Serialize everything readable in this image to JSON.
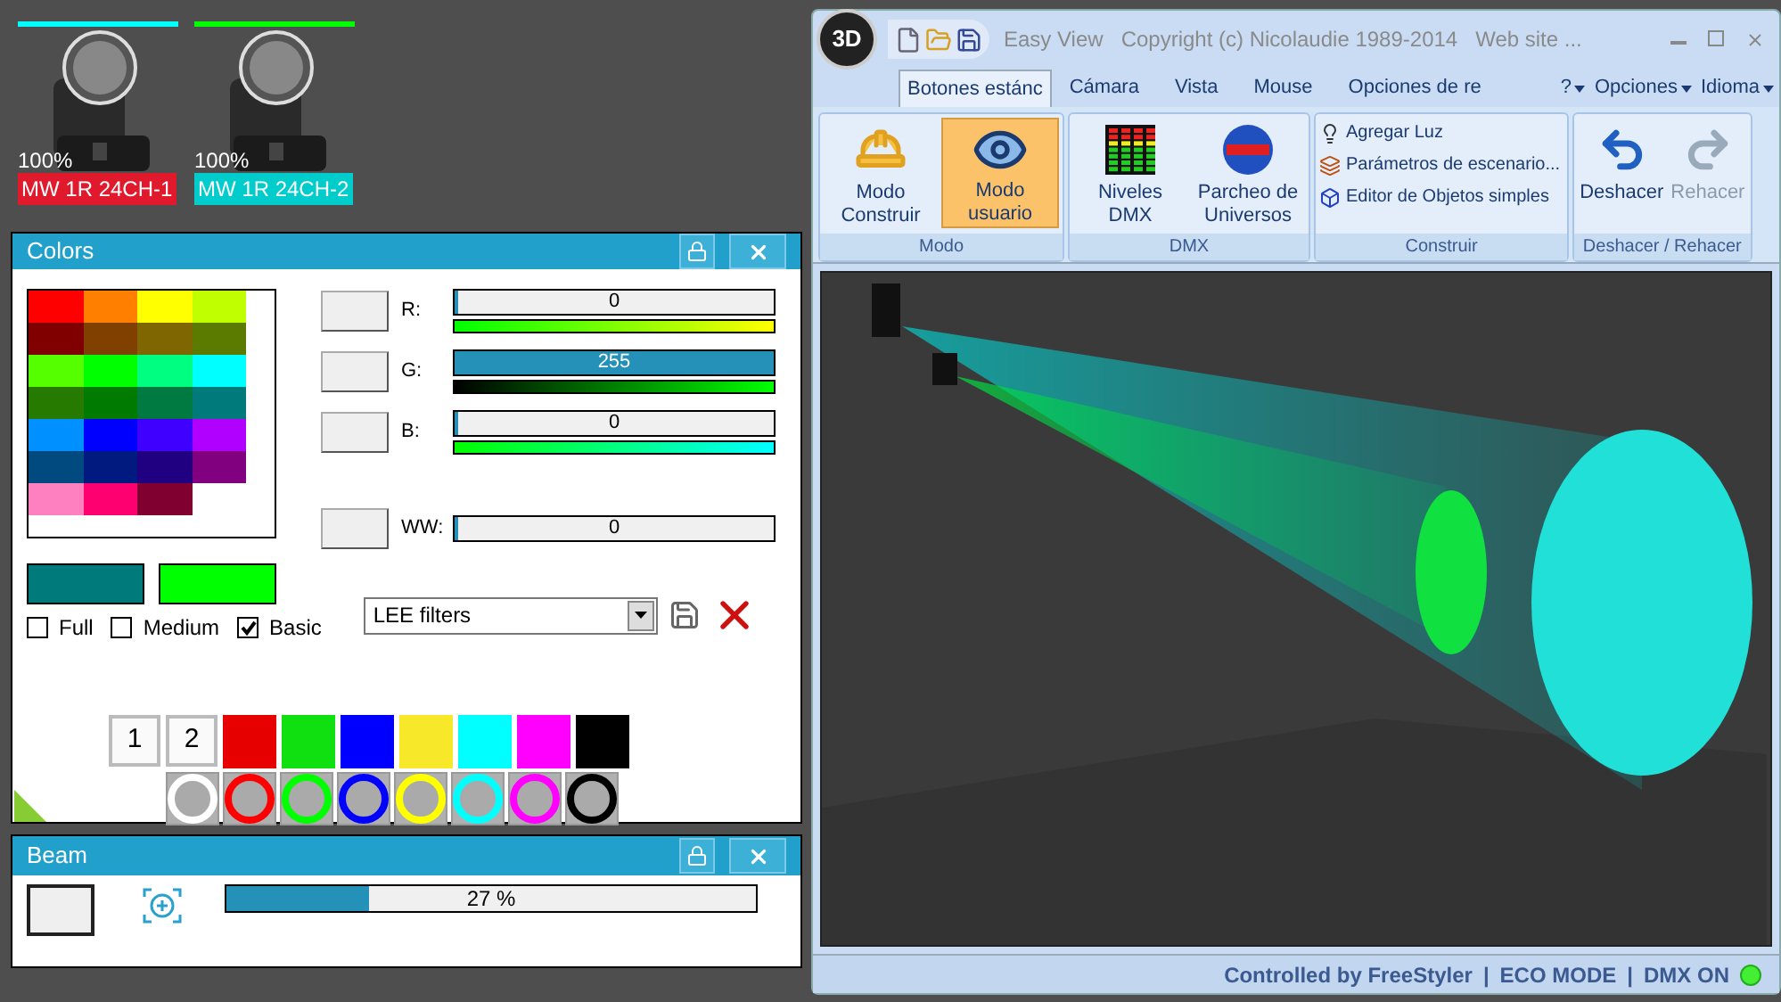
{
  "fixtures": [
    {
      "indicator": {
        "color": "#00ffff"
      },
      "intensity": "100%",
      "name": "MW 1R 24CH-1",
      "color": "#e01a2c"
    },
    {
      "indicator": {
        "color": "#00ff00"
      },
      "intensity": "100%",
      "name": "MW 1R 24CH-2",
      "color": "#00cccc"
    }
  ],
  "colors_panel": {
    "title": "Colors",
    "palette": [
      {
        "color": "#ff0000"
      },
      {
        "color": "#ff8000"
      },
      {
        "color": "#ffff00"
      },
      {
        "color": "#bfff00"
      },
      {
        "color": "#800000"
      },
      {
        "color": "#804000"
      },
      {
        "color": "#806600"
      },
      {
        "color": "#5a7a00"
      },
      {
        "color": "#55ff00"
      },
      {
        "color": "#00ff00"
      },
      {
        "color": "#00ff80"
      },
      {
        "color": "#00ffff"
      },
      {
        "color": "#267a00"
      },
      {
        "color": "#007a00"
      },
      {
        "color": "#007a40"
      },
      {
        "color": "#007a7a"
      },
      {
        "color": "#0090ff"
      },
      {
        "color": "#0000ff"
      },
      {
        "color": "#4000ff"
      },
      {
        "color": "#b000ff"
      },
      {
        "color": "#004a80"
      },
      {
        "color": "#001a80"
      },
      {
        "color": "#200080"
      },
      {
        "color": "#800080"
      },
      {
        "color": "#ff80c0"
      },
      {
        "color": "#ff0070"
      },
      {
        "color": "#800030"
      },
      {
        "color": "#ffffff"
      }
    ],
    "channels": [
      {
        "label": "R:",
        "reading": "0",
        "level": 0
      },
      {
        "label": "G:",
        "reading": "255",
        "level": 1
      },
      {
        "label": "B:",
        "reading": "0",
        "level": 0
      },
      {
        "label": "WW:",
        "reading": "0",
        "level": 0
      }
    ],
    "previews": [
      {
        "color": "#007a7a"
      },
      {
        "color": "#00ff00"
      }
    ],
    "palette_modes": [
      {
        "label": "Full",
        "checked": false
      },
      {
        "label": "Medium",
        "checked": false
      },
      {
        "label": "Basic",
        "checked": true
      }
    ],
    "filter_select": {
      "value": "LEE filters"
    },
    "presets": [
      {
        "label": "1"
      },
      {
        "label": "2"
      }
    ],
    "swatches": [
      {
        "color": "#e60000"
      },
      {
        "color": "#10e010"
      },
      {
        "color": "#0000ff"
      },
      {
        "color": "#f8e82a"
      },
      {
        "color": "#00ffff"
      },
      {
        "color": "#ff00ff"
      },
      {
        "color": "#000000"
      }
    ],
    "rings": [
      {
        "color": "#ffffff"
      },
      {
        "color": "#ff0000"
      },
      {
        "color": "#00ff00"
      },
      {
        "color": "#0000ff"
      },
      {
        "color": "#ffff00"
      },
      {
        "color": "#00ffff"
      },
      {
        "color": "#ff00ff"
      },
      {
        "color": "#000000"
      }
    ]
  },
  "beam_panel": {
    "title": "Beam",
    "level": 0.27,
    "reading": "27 %"
  },
  "window": {
    "logo": "3D",
    "title": "Easy View",
    "copyright": "Copyright (c) Nicolaudie 1989-2014",
    "website": "Web site ...",
    "tabs": [
      {
        "label": "Botones estánc",
        "selected": true
      },
      {
        "label": "Cámara",
        "selected": false
      },
      {
        "label": "Vista",
        "selected": false
      },
      {
        "label": "Mouse",
        "selected": false
      },
      {
        "label": "Opciones de re",
        "selected": false
      }
    ],
    "menus": [
      "?",
      "Opciones",
      "Idioma"
    ],
    "groups": [
      {
        "label": "Modo",
        "kind": "large",
        "items": [
          {
            "label": "Modo Construir",
            "selected": false,
            "disabled": false
          },
          {
            "label": "Modo usuario",
            "selected": true,
            "disabled": false
          }
        ]
      },
      {
        "label": "DMX",
        "kind": "large",
        "items": [
          {
            "label": "Niveles DMX",
            "selected": false,
            "disabled": false
          },
          {
            "label": "Parcheo de Universos",
            "selected": false,
            "disabled": false
          }
        ]
      },
      {
        "label": "Construir",
        "kind": "list",
        "items": [
          {
            "label": "Agregar Luz"
          },
          {
            "label": "Parámetros de escenario..."
          },
          {
            "label": "Editor de Objetos simples"
          }
        ]
      },
      {
        "label": "Deshacer / Rehacer",
        "kind": "large",
        "items": [
          {
            "label": "Deshacer",
            "selected": false,
            "disabled": false
          },
          {
            "label": "Rehacer",
            "selected": false,
            "disabled": true
          }
        ]
      }
    ],
    "status": [
      "Controlled by FreeStyler",
      "|",
      "ECO MODE",
      "|",
      "DMX ON"
    ]
  }
}
